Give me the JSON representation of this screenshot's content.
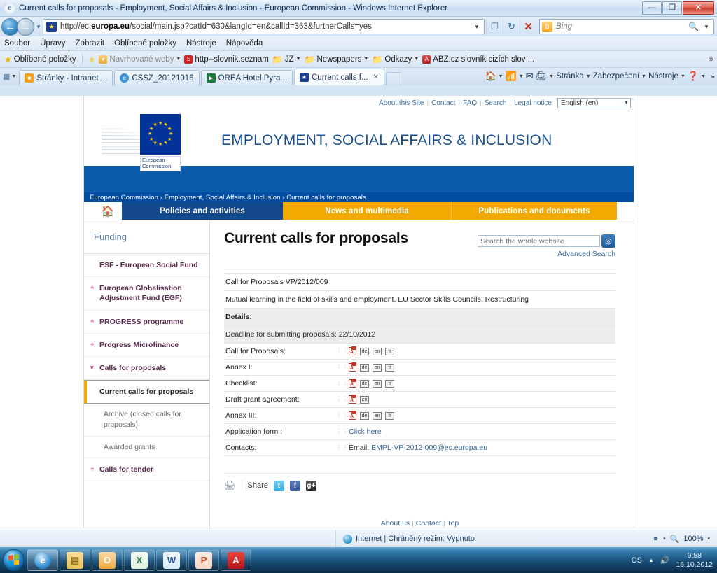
{
  "window": {
    "title": "Current calls for proposals - Employment, Social Affairs & Inclusion - European Commission - Windows Internet Explorer",
    "minimize_label": "—",
    "maximize_label": "❐",
    "close_label": "✕"
  },
  "browser": {
    "url": "http://ec.europa.eu/social/main.jsp?catId=630&langId=en&callId=363&furtherCalls=yes",
    "url_prefix": "http://ec.",
    "url_domain": "europa.eu",
    "url_suffix": "/social/main.jsp?catId=630&langId=en&callId=363&furtherCalls=yes",
    "search_placeholder": "Bing",
    "back_icon": "back-arrow-icon",
    "forward_icon": "forward-arrow-icon",
    "compat_icon": "compatibility-view-icon",
    "refresh_icon": "refresh-icon",
    "stop_icon": "stop-icon",
    "menu": [
      "Soubor",
      "Úpravy",
      "Zobrazit",
      "Oblíbené položky",
      "Nástroje",
      "Nápověda"
    ],
    "favorites_bar": {
      "button": "Oblíbené položky",
      "items": [
        {
          "label": "Navrhované weby",
          "icon": "suggested-sites-icon",
          "caret": true,
          "muted": true
        },
        {
          "label": "http--slovnik.seznam",
          "icon": "seznam-icon",
          "caret": false,
          "muted": false
        },
        {
          "label": "JZ",
          "icon": "folder-icon",
          "caret": true,
          "muted": false
        },
        {
          "label": "Newspapers",
          "icon": "folder-icon",
          "caret": true,
          "muted": false
        },
        {
          "label": "Odkazy",
          "icon": "folder-icon",
          "caret": true,
          "muted": false
        },
        {
          "label": "ABZ.cz slovník cizích slov ...",
          "icon": "abz-icon",
          "caret": false,
          "muted": false
        }
      ],
      "overflow": "»"
    },
    "tabs": [
      {
        "label": "Stránky - Intranet ...",
        "active": false,
        "icon_color": "#f0a020"
      },
      {
        "label": "CSSZ_20121016",
        "active": false,
        "icon_color": "#3a93d4"
      },
      {
        "label": "OREA Hotel Pyra...",
        "active": false,
        "icon_color": "#1f7a3d"
      },
      {
        "label": "Current calls f...",
        "active": true,
        "icon_color": "#1c3f94"
      }
    ],
    "tab_close": "✕",
    "command_bar": [
      {
        "label": "Stránka",
        "caret": true
      },
      {
        "label": "Zabezpečení",
        "caret": true
      },
      {
        "label": "Nástroje",
        "caret": true
      }
    ],
    "command_icons": [
      "home-icon",
      "rss-feed-icon",
      "mail-icon",
      "print-icon",
      "help-icon"
    ],
    "command_overflow": "»"
  },
  "site": {
    "top_links": [
      "About this Site",
      "Contact",
      "FAQ",
      "Search",
      "Legal notice"
    ],
    "language_selected": "English (en)",
    "logo_label": "European\nCommission",
    "logo_line1": "European",
    "logo_line2": "Commission",
    "header_title": "EMPLOYMENT, SOCIAL AFFAIRS & INCLUSION",
    "breadcrumb": "European Commission › Employment, Social Affairs & Inclusion › Current calls for proposals",
    "nav": {
      "home_icon": "home-icon",
      "tabs": [
        {
          "label": "Policies and activities",
          "active": true
        },
        {
          "label": "News and multimedia",
          "active": false
        },
        {
          "label": "Publications and documents",
          "active": false
        }
      ]
    }
  },
  "sidebar": {
    "title": "Funding",
    "items": [
      {
        "label": "ESF - European Social Fund",
        "expander": "",
        "state": "leaf"
      },
      {
        "label": "European Globalisation Adjustment Fund (EGF)",
        "expander": "+",
        "state": "collapsed"
      },
      {
        "label": "PROGRESS programme",
        "expander": "+",
        "state": "collapsed"
      },
      {
        "label": "Progress Microfinance",
        "expander": "+",
        "state": "collapsed"
      },
      {
        "label": "Calls for proposals",
        "expander": "▾",
        "state": "expanded"
      }
    ],
    "active_item": "Current calls for proposals",
    "sub_items": [
      "Archive (closed calls for proposals)",
      "Awarded grants"
    ],
    "last_item": {
      "label": "Calls for tender",
      "expander": "+"
    }
  },
  "main": {
    "page_title": "Current calls for proposals",
    "search_placeholder": "Search the whole website",
    "search_value": "",
    "search_button_icon": "search-icon",
    "advanced_search": "Advanced Search",
    "call_reference": "Call for Proposals VP/2012/009",
    "call_description": "Mutual learning in the field of skills and employment, EU Sector Skills Councils, Restructuring",
    "details_header": "Details:",
    "deadline": "Deadline for submitting proposals: 22/10/2012",
    "rows": [
      {
        "label": "Call for Proposals:",
        "type": "files",
        "pdf": true,
        "langs": [
          "de",
          "en",
          "fr"
        ]
      },
      {
        "label": "Annex I:",
        "type": "files",
        "pdf": true,
        "langs": [
          "de",
          "en",
          "fr"
        ]
      },
      {
        "label": "Checklist:",
        "type": "files",
        "pdf": true,
        "langs": [
          "de",
          "en",
          "fr"
        ]
      },
      {
        "label": "Draft grant agreement:",
        "type": "files",
        "pdf": true,
        "langs": [
          "en"
        ]
      },
      {
        "label": "Annex III:",
        "type": "files",
        "pdf": true,
        "langs": [
          "de",
          "en",
          "fr"
        ]
      },
      {
        "label": "Application form :",
        "type": "link",
        "link_text": "Click here"
      },
      {
        "label": "Contacts:",
        "type": "email",
        "prefix": "Email:",
        "email": "EMPL-VP-2012-009@ec.europa.eu"
      }
    ],
    "share": {
      "print_icon": "print-icon",
      "label": "Share",
      "networks": [
        {
          "name": "twitter-icon",
          "glyph": "t"
        },
        {
          "name": "facebook-icon",
          "glyph": "f"
        },
        {
          "name": "googleplus-icon",
          "glyph": "g+"
        }
      ]
    },
    "footer_links": [
      "About us",
      "Contact",
      "Top"
    ],
    "footer_sep": "|"
  },
  "status_bar": {
    "zone_text": "Internet | Chráněný režim: Vypnuto",
    "zone_icon": "internet-zone-icon",
    "privacy_icon": "privacy-icon",
    "zoom_icon": "zoom-icon",
    "zoom_level": "100%",
    "caret": "▾"
  },
  "taskbar": {
    "start_icon": "windows-start-icon",
    "buttons": [
      {
        "name": "internet-explorer-taskbar-icon",
        "glyph": "e",
        "active": true
      },
      {
        "name": "windows-explorer-taskbar-icon",
        "glyph": "▤",
        "active": false
      },
      {
        "name": "outlook-taskbar-icon",
        "glyph": "O",
        "active": false
      },
      {
        "name": "excel-taskbar-icon",
        "glyph": "X",
        "active": false
      },
      {
        "name": "word-taskbar-icon",
        "glyph": "W",
        "active": false
      },
      {
        "name": "powerpoint-taskbar-icon",
        "glyph": "P",
        "active": false
      },
      {
        "name": "acrobat-taskbar-icon",
        "glyph": "A",
        "active": false
      }
    ],
    "tray": {
      "language": "CS",
      "show_hidden_icon": "▲",
      "volume_icon": "volume-icon",
      "time": "9:58",
      "date": "16.10.2012"
    }
  },
  "colors": {
    "eu_blue": "#034ea2",
    "header_blue": "#0b5bab",
    "nav_blue": "#134a8e",
    "nav_orange": "#f2a900",
    "link_blue": "#36689c",
    "sidebar_magenta": "#5a2a4e",
    "expander_pink": "#c0307a"
  }
}
